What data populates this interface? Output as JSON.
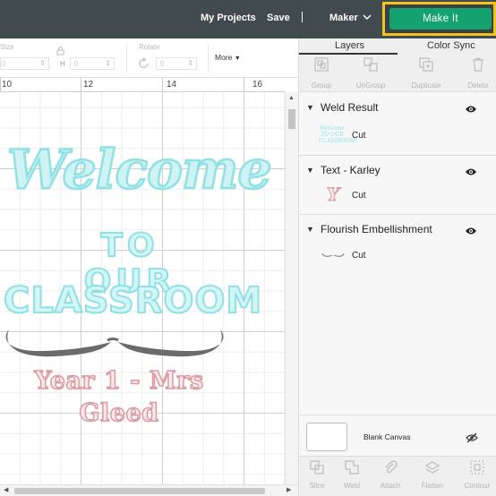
{
  "topbar": {
    "my_projects": "My Projects",
    "save": "Save",
    "divider": "|",
    "machine": "Maker",
    "make_it": "Make It"
  },
  "editbar": {
    "size_label": "Size",
    "w_label": "W",
    "h_label": "H",
    "w_value": "0",
    "h_value": "0",
    "rotate_label": "Rotate",
    "rotate_value": "0",
    "more": "More"
  },
  "ruler": {
    "marks": [
      "10",
      "12",
      "14",
      "16"
    ]
  },
  "design": {
    "welcome": "Welcome",
    "to_our": "TO OUR",
    "classroom": "CLASSROOM",
    "name_line": "Year 1 - Mrs Gleed"
  },
  "panel": {
    "tabs": [
      "Layers",
      "Color Sync"
    ],
    "tools": [
      "Group",
      "UnGroup",
      "Duplicate",
      "Delete"
    ],
    "layers": [
      {
        "name": "Weld Result",
        "operation": "Cut",
        "thumb_text": "Welcome TO OUR CLASSROOM"
      },
      {
        "name": "Text - Karley",
        "operation": "Cut",
        "thumb_text": "Y"
      },
      {
        "name": "Flourish Embellishment",
        "operation": "Cut"
      }
    ],
    "blank_canvas": "Blank Canvas",
    "bottom_tools": [
      "Slice",
      "Weld",
      "Attach",
      "Flatten",
      "Contour"
    ]
  },
  "colors": {
    "topbar_bg": "#414a4f",
    "make_it_green": "#14a271",
    "highlight_yellow": "#f0c419",
    "design_teal": "#8fe1e3",
    "design_pink": "#d99aa0",
    "flourish_gray": "#6b6b6b"
  }
}
